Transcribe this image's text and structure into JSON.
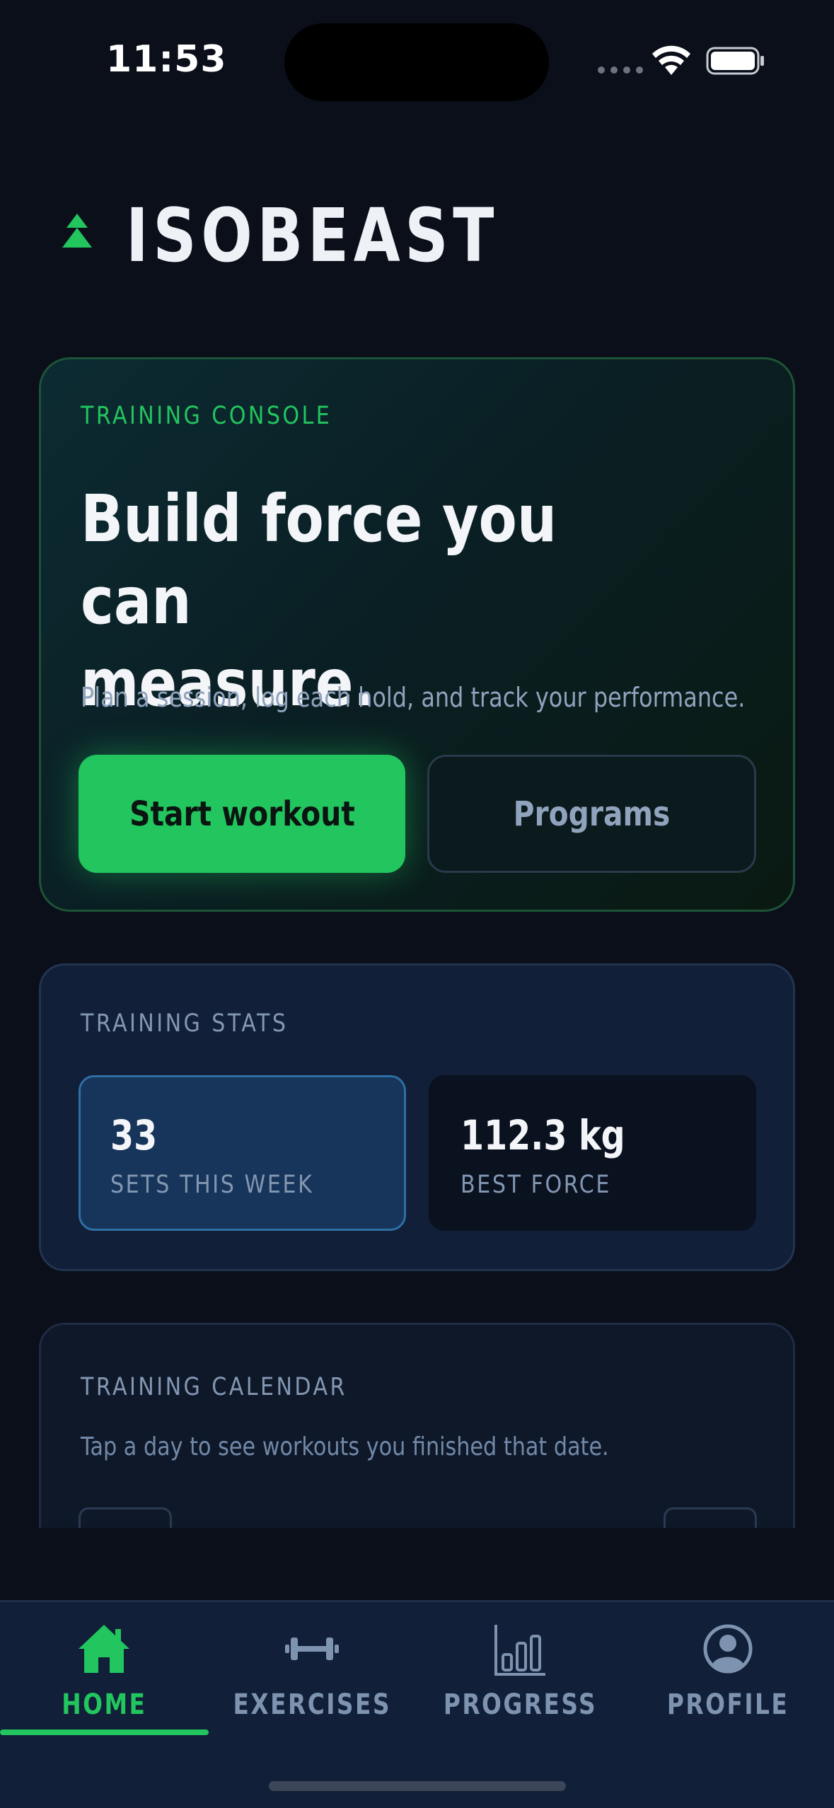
{
  "status_bar": {
    "time": "11:53"
  },
  "brand": {
    "name": "ISOBEAST",
    "icon": "double-chevron-up-icon",
    "accent": "#22c55e"
  },
  "console": {
    "eyebrow": "TRAINING CONSOLE",
    "headline": "Build force you can\nmeasure.",
    "description": "Plan a session, log each hold, and track your performance.",
    "primary_button": "Start workout",
    "secondary_button": "Programs"
  },
  "stats": {
    "eyebrow": "TRAINING STATS",
    "items": [
      {
        "value": "33",
        "label": "SETS THIS WEEK"
      },
      {
        "value": "112.3 kg",
        "label": "BEST FORCE"
      }
    ]
  },
  "calendar": {
    "eyebrow": "TRAINING CALENDAR",
    "description": "Tap a day to see workouts you finished that date."
  },
  "tabbar": {
    "active": "HOME",
    "active_color": "#22c55e",
    "inactive_color": "#7e93b0",
    "tabs": [
      {
        "label": "HOME",
        "icon": "home-icon"
      },
      {
        "label": "EXERCISES",
        "icon": "dumbbell-icon"
      },
      {
        "label": "PROGRESS",
        "icon": "bar-chart-icon"
      },
      {
        "label": "PROFILE",
        "icon": "user-circle-icon"
      }
    ]
  }
}
